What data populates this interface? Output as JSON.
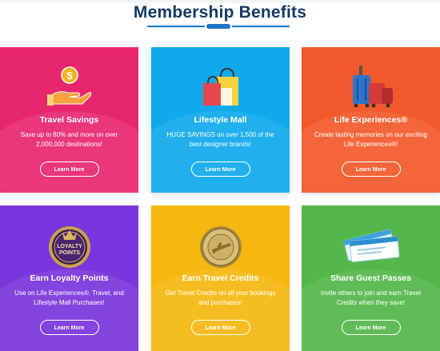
{
  "header": {
    "title": "Membership Benefits"
  },
  "cards": [
    {
      "title": "Travel Savings",
      "desc": "Save up to 80% and more on over 2,000,000 destinations!",
      "button": "Learn More",
      "icon": "hand-dollar-icon"
    },
    {
      "title": "Lifestyle Mall",
      "desc": "HUGE SAVINGS on over 1,500 of the best designer brands!",
      "button": "Learn More",
      "icon": "shopping-bags-icon"
    },
    {
      "title": "Life Experiences®",
      "desc": "Create lasting memories on our exciting Life Experiences®!",
      "button": "Learn More",
      "icon": "luggage-icon"
    },
    {
      "title": "Earn Loyalty Points",
      "desc": "Use on Life Experiences®, Travel, and Lifestyle Mall Purchases!",
      "button": "Learn More",
      "icon": "loyalty-points-badge-icon",
      "badge_text": [
        "LOYALTY",
        "POINTS"
      ]
    },
    {
      "title": "Earn Travel Credits",
      "desc": "Get Travel Credits on all your bookings and purchases!",
      "button": "Learn More",
      "icon": "travel-credit-coin-icon"
    },
    {
      "title": "Share Guest Passes",
      "desc": "Invite others to join and earn Travel Credits when they save!",
      "button": "Learn More",
      "icon": "guest-pass-tickets-icon"
    }
  ],
  "colors": {
    "title": "#123a68",
    "travel": "#e8266e",
    "lifestyle": "#10a9ec",
    "life": "#f2592c",
    "loyalty": "#7a35dc",
    "credits": "#f6b810",
    "share": "#53b749"
  }
}
